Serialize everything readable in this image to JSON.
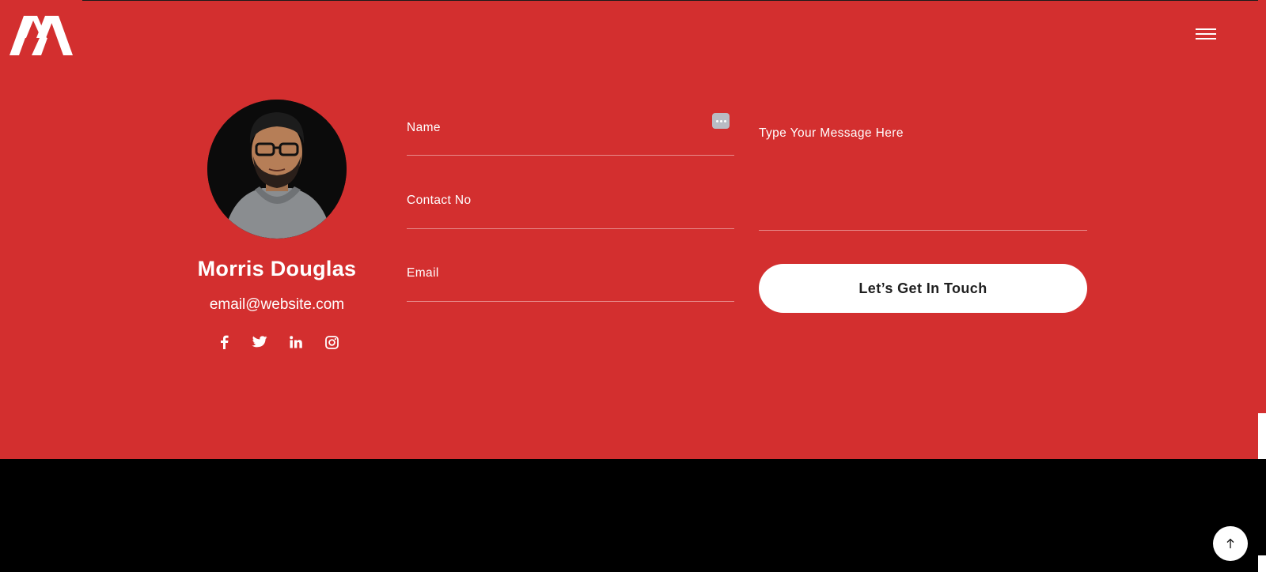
{
  "header": {
    "logo_icon": "mirrored-m-logo-icon",
    "menu_icon": "hamburger-menu-icon"
  },
  "profile": {
    "name": "Morris Douglas",
    "email": "email@website.com",
    "avatar_icon": "profile-photo",
    "socials": [
      {
        "name": "facebook-icon"
      },
      {
        "name": "twitter-icon"
      },
      {
        "name": "linkedin-icon"
      },
      {
        "name": "instagram-icon"
      }
    ]
  },
  "form": {
    "name_label": "Name",
    "contact_label": "Contact No",
    "email_label": "Email",
    "message_label": "Type Your Message Here",
    "submit_label": "Let’s Get In Touch",
    "password_manager_icon": "password-manager-icon"
  },
  "footer": {
    "back_to_top_icon": "arrow-up-icon"
  },
  "colors": {
    "primary_red": "#d32f2f",
    "footer_black": "#000000",
    "white": "#ffffff"
  }
}
